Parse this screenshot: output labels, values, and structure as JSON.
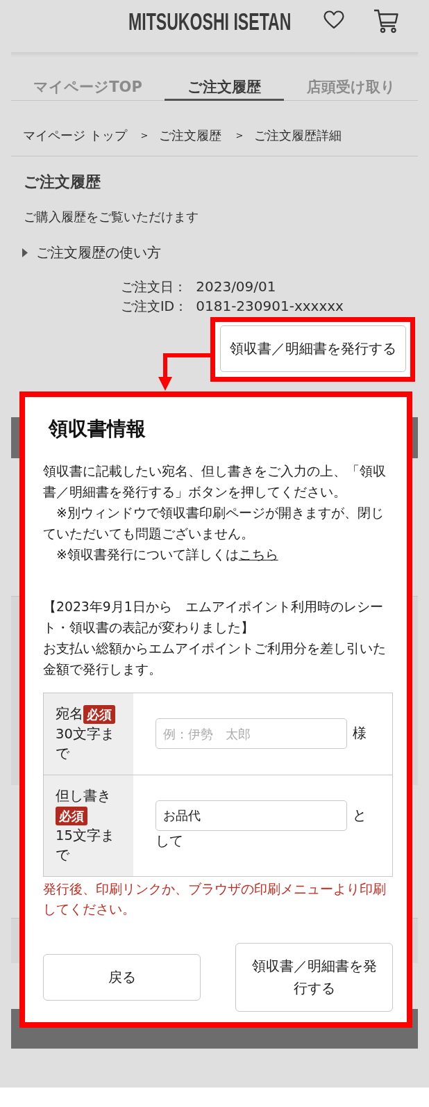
{
  "header": {
    "logo": "MITSUKOSHI ISETAN"
  },
  "tabs": [
    {
      "label": "マイページTOP",
      "selected": false
    },
    {
      "label": "ご注文履歴",
      "selected": true
    },
    {
      "label": "店頭受け取り",
      "selected": false
    }
  ],
  "breadcrumb": [
    {
      "kind": "link",
      "text": "マイページ トップ"
    },
    {
      "kind": "separator",
      "text": ">"
    },
    {
      "kind": "link",
      "text": "ご注文履歴"
    },
    {
      "kind": "separator",
      "text": ">"
    },
    {
      "kind": "current",
      "text": "ご注文履歴詳細"
    }
  ],
  "page": {
    "title": "ご注文履歴",
    "description": "ご購入履歴をご覧いただけます",
    "help_toggle": {
      "label": "ご注文履歴の使い方",
      "expanded": false
    }
  },
  "order": {
    "fields": [
      {
        "label": "ご注文日：",
        "value": "2023/09/01"
      },
      {
        "label": "ご注文ID：",
        "value": "0181-230901-xxxxxx"
      }
    ],
    "issue_button": {
      "label": "領収書／明細書を発行する",
      "highlighted": true
    }
  },
  "dialog": {
    "title": "領収書情報",
    "highlighted": true,
    "intro": [
      {
        "text": "領収書に記載したい宛名、但し書きをご入力の上、「領収書／明細書を発行する」ボタンを押してください。"
      },
      {
        "text": "　※別ウィンドウで領収書印刷ページが開きますが、閉じていただいても問題ございません。"
      },
      {
        "text": "　※領収書発行について詳しくは",
        "link": "こちら"
      }
    ],
    "notice": [
      "【2023年9月1日から　エムアイポイント利用時のレシート・領収書の表記が変わりました】",
      "お支払い総額からエムアイポイントご利用分を差し引いた金額で発行します。"
    ],
    "form": [
      {
        "label": "宛名",
        "badge": "必須",
        "limit": "30文字まで",
        "placeholder": "例：伊勢　太郎",
        "suffix_lines": [
          "様"
        ]
      },
      {
        "label": "但し書き",
        "badge": "必須",
        "limit": "15文字まで",
        "value": "お品代",
        "suffix_lines": [
          "と",
          "して"
        ]
      }
    ],
    "warning": "発行後、印刷リンクか、ブラウザの印刷メニューより印刷してください。",
    "buttons": [
      {
        "kind": "secondary",
        "label": "戻る"
      },
      {
        "kind": "primary",
        "label": "領収書／明細書を発行する"
      }
    ]
  }
}
